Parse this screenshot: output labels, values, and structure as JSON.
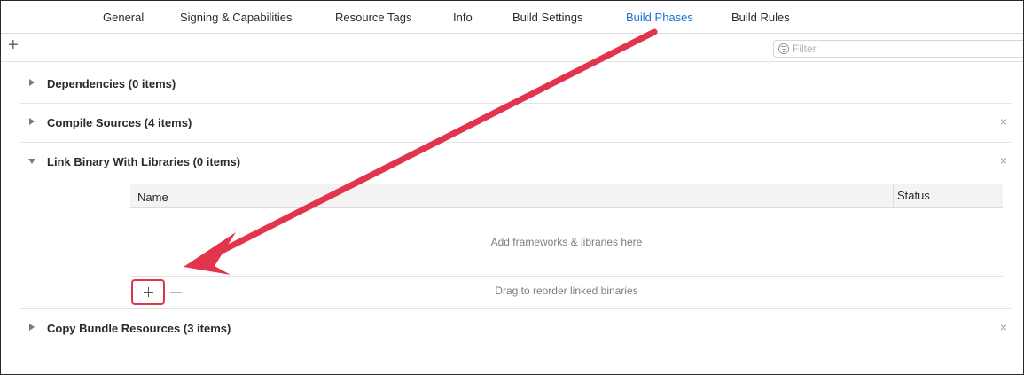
{
  "tabs": [
    {
      "label": "General",
      "active": false
    },
    {
      "label": "Signing & Capabilities",
      "active": false
    },
    {
      "label": "Resource Tags",
      "active": false
    },
    {
      "label": "Info",
      "active": false
    },
    {
      "label": "Build Settings",
      "active": false
    },
    {
      "label": "Build Phases",
      "active": true
    },
    {
      "label": "Build Rules",
      "active": false
    }
  ],
  "toolbar": {
    "add_label": "+",
    "filter_placeholder": "Filter"
  },
  "phases": [
    {
      "title": "Dependencies (0 items)",
      "expanded": false,
      "closable": false
    },
    {
      "title": "Compile Sources (4 items)",
      "expanded": false,
      "closable": true
    },
    {
      "title": "Link Binary With Libraries (0 items)",
      "expanded": true,
      "closable": true
    },
    {
      "title": "Copy Bundle Resources (3 items)",
      "expanded": false,
      "closable": true
    }
  ],
  "close_symbol": "×",
  "link_table": {
    "columns": [
      "Name",
      "Status"
    ],
    "empty_text": "Add frameworks & libraries here",
    "footer_hint": "Drag to reorder linked binaries"
  },
  "annotation": {
    "arrow_color": "#e2344b",
    "highlight_color": "#e2344b"
  },
  "colors": {
    "accent": "#1f6fd6"
  }
}
